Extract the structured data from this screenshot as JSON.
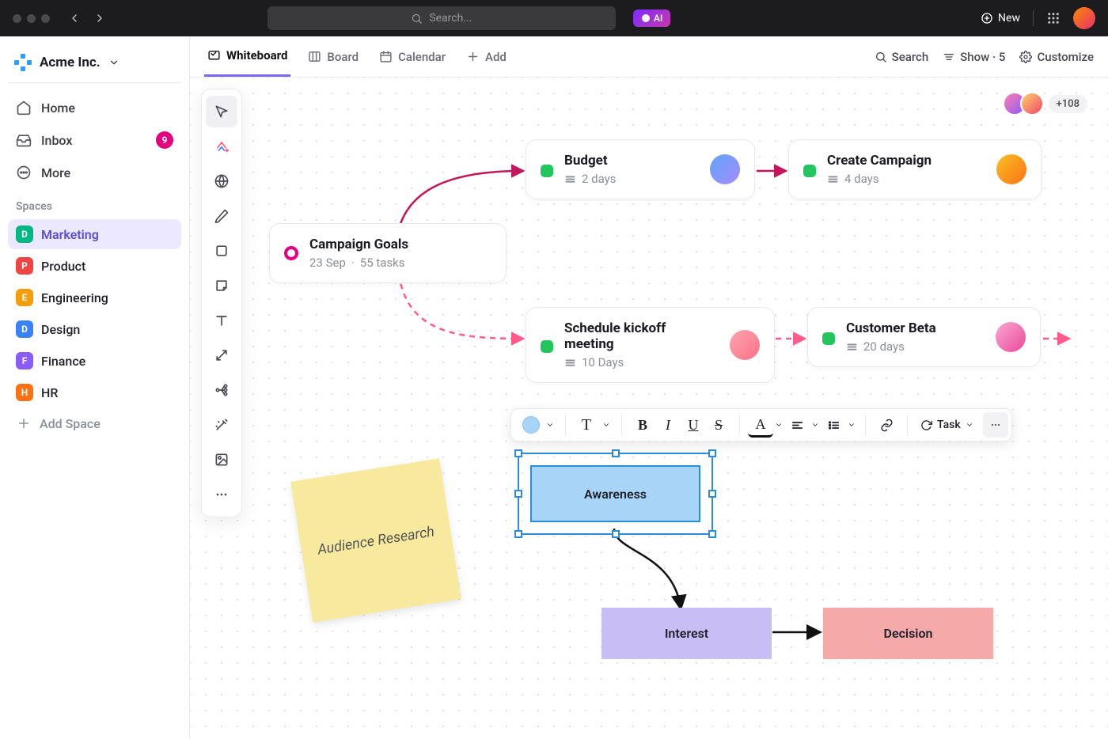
{
  "titlebar": {
    "search_placeholder": "Search...",
    "ai_label": "AI",
    "new_label": "New"
  },
  "workspace": {
    "name": "Acme Inc."
  },
  "nav": {
    "home": "Home",
    "inbox": "Inbox",
    "inbox_count": "9",
    "more": "More"
  },
  "spaces": {
    "heading": "Spaces",
    "items": [
      {
        "letter": "D",
        "label": "Marketing",
        "color": "#00b884",
        "active": true
      },
      {
        "letter": "P",
        "label": "Product",
        "color": "#ef4444"
      },
      {
        "letter": "E",
        "label": "Engineering",
        "color": "#f59e0b"
      },
      {
        "letter": "D",
        "label": "Design",
        "color": "#3b82f6"
      },
      {
        "letter": "F",
        "label": "Finance",
        "color": "#8b5cf6"
      },
      {
        "letter": "H",
        "label": "HR",
        "color": "#f97316"
      }
    ],
    "add_label": "Add Space"
  },
  "views": {
    "whiteboard": "Whiteboard",
    "board": "Board",
    "calendar": "Calendar",
    "add": "Add",
    "search": "Search",
    "show": "Show · 5",
    "customize": "Customize"
  },
  "collaborators": {
    "overflow": "+108"
  },
  "cards": {
    "goals": {
      "title": "Campaign Goals",
      "date": "23 Sep",
      "sep": "·",
      "tasks": "55 tasks"
    },
    "budget": {
      "title": "Budget",
      "duration": "2 days"
    },
    "create": {
      "title": "Create Campaign",
      "duration": "4 days"
    },
    "kickoff": {
      "title": "Schedule kickoff meeting",
      "duration": "10 Days"
    },
    "beta": {
      "title": "Customer Beta",
      "duration": "20 days"
    }
  },
  "sticky": {
    "text": "Audience Research"
  },
  "flow": {
    "awareness": "Awareness",
    "interest": "Interest",
    "decision": "Decision"
  },
  "toolbar": {
    "task_label": "Task"
  }
}
